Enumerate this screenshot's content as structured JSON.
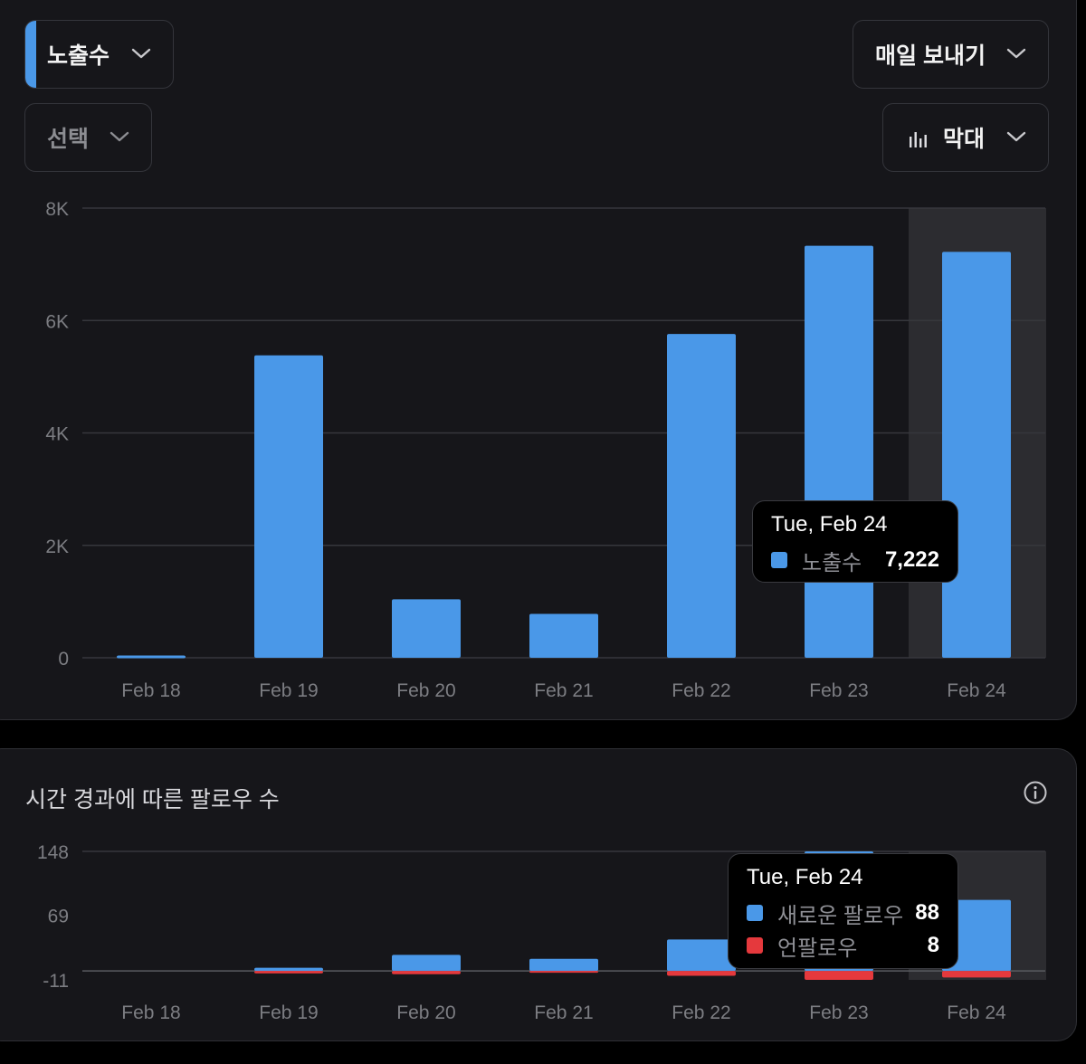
{
  "controls": {
    "metric_label": "노출수",
    "select_label": "선택",
    "export_label": "매일 보내기",
    "chart_type_label": "막대",
    "accent_color": "#4a98e8"
  },
  "icons": {
    "dropdown": "chevron-down-icon",
    "chart_type": "bar-chart-icon",
    "info": "info-icon"
  },
  "chart_data": [
    {
      "type": "bar",
      "categories": [
        "Feb 18",
        "Feb 19",
        "Feb 20",
        "Feb 21",
        "Feb 22",
        "Feb 23",
        "Feb 24"
      ],
      "series": [
        {
          "name": "노출수",
          "color": "#4a98e8",
          "values": [
            40,
            5380,
            1040,
            780,
            5760,
            7330,
            7222
          ]
        }
      ],
      "yticks": [
        0,
        2000,
        4000,
        6000,
        8000
      ],
      "ytick_labels": [
        "0",
        "2K",
        "4K",
        "6K",
        "8K"
      ],
      "ylim": [
        0,
        8000
      ],
      "highlighted_category": "Feb 24",
      "grid": true,
      "tooltip": {
        "title": "Tue, Feb 24",
        "rows": [
          {
            "name": "노출수",
            "value": "7,222",
            "color": "#4a98e8"
          }
        ]
      }
    },
    {
      "type": "bar",
      "title": "시간 경과에 따른 팔로우 수",
      "categories": [
        "Feb 18",
        "Feb 19",
        "Feb 20",
        "Feb 21",
        "Feb 22",
        "Feb 23",
        "Feb 24"
      ],
      "series": [
        {
          "name": "새로운 팔로우",
          "color": "#4a98e8",
          "values": [
            0,
            4,
            20,
            15,
            39,
            148,
            88
          ]
        },
        {
          "name": "언팔로우",
          "color": "#e5393d",
          "values": [
            0,
            3,
            4,
            2,
            6,
            11,
            8
          ]
        }
      ],
      "yticks": [
        -11,
        69,
        148
      ],
      "ytick_labels": [
        "-11",
        "69",
        "148"
      ],
      "ylim": [
        -11,
        148
      ],
      "highlighted_category": "Feb 24",
      "grid": true,
      "tooltip": {
        "title": "Tue, Feb 24",
        "rows": [
          {
            "name": "새로운 팔로우",
            "value": "88",
            "color": "#4a98e8"
          },
          {
            "name": "언팔로우",
            "value": "8",
            "color": "#e5393d"
          }
        ]
      }
    }
  ]
}
